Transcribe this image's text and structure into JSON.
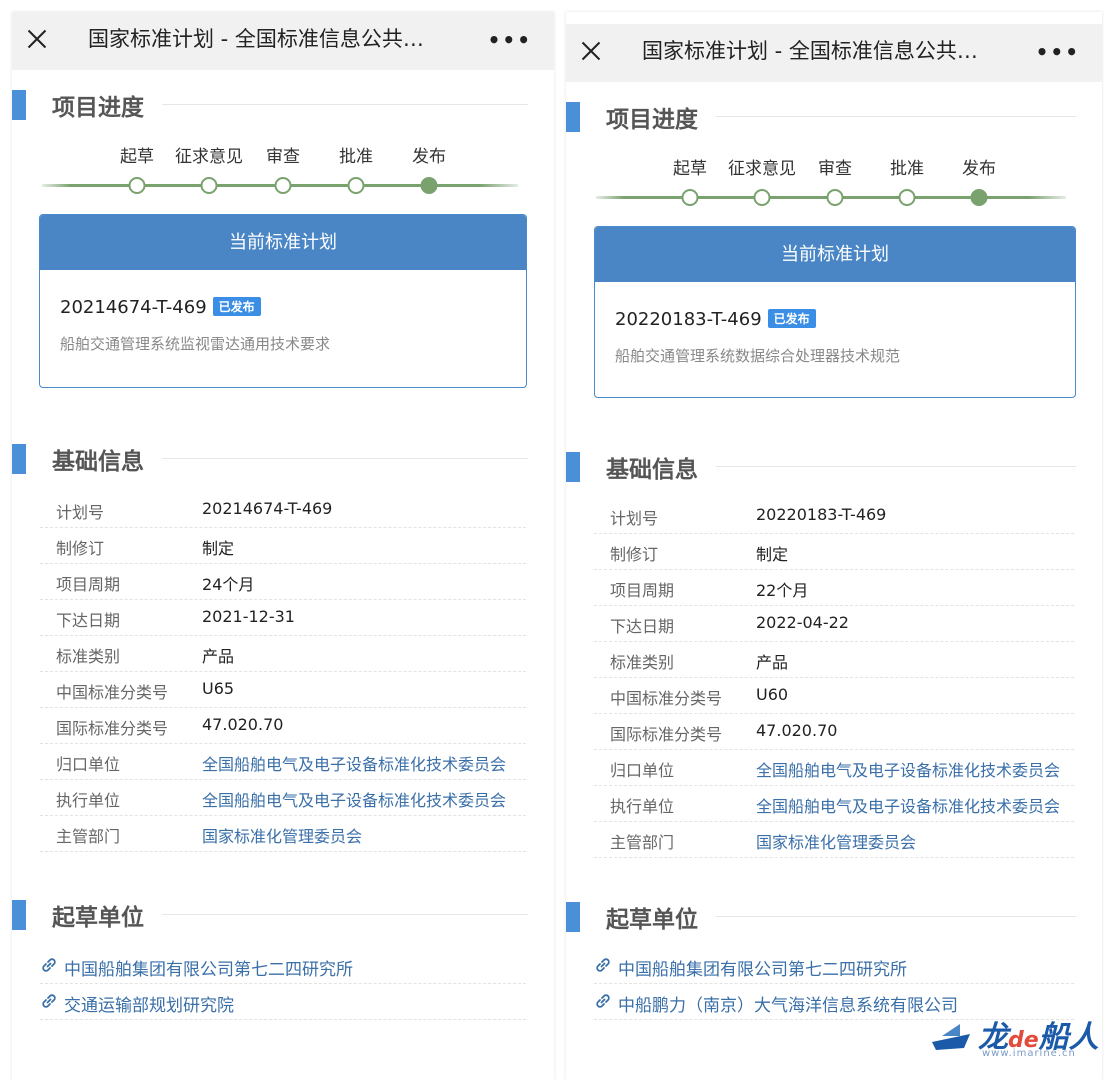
{
  "left": {
    "title": "国家标准计划 - 全国标准信息公共…",
    "progress_title": "项目进度",
    "steps": [
      "起草",
      "征求意见",
      "审查",
      "批准",
      "发布"
    ],
    "card": {
      "header": "当前标准计划",
      "plan_no": "20214674-T-469",
      "badge": "已发布",
      "name": "船舶交通管理系统监视雷达通用技术要求"
    },
    "basic_title": "基础信息",
    "info": [
      {
        "k": "计划号",
        "v": "20214674-T-469"
      },
      {
        "k": "制修订",
        "v": "制定"
      },
      {
        "k": "项目周期",
        "v": "24个月"
      },
      {
        "k": "下达日期",
        "v": "2021-12-31"
      },
      {
        "k": "标准类别",
        "v": "产品"
      },
      {
        "k": "中国标准分类号",
        "v": "U65"
      },
      {
        "k": "国际标准分类号",
        "v": "47.020.70"
      },
      {
        "k": "归口单位",
        "v": "全国船舶电气及电子设备标准化技术委员会"
      },
      {
        "k": "执行单位",
        "v": "全国船舶电气及电子设备标准化技术委员会"
      },
      {
        "k": "主管部门",
        "v": "国家标准化管理委员会"
      }
    ],
    "draft_title": "起草单位",
    "orgs": [
      "中国船舶集团有限公司第七二四研究所",
      "交通运输部规划研究院"
    ]
  },
  "right": {
    "title": "国家标准计划 - 全国标准信息公共…",
    "progress_title": "项目进度",
    "steps": [
      "起草",
      "征求意见",
      "审查",
      "批准",
      "发布"
    ],
    "card": {
      "header": "当前标准计划",
      "plan_no": "20220183-T-469",
      "badge": "已发布",
      "name": "船舶交通管理系统数据综合处理器技术规范"
    },
    "basic_title": "基础信息",
    "info": [
      {
        "k": "计划号",
        "v": "20220183-T-469"
      },
      {
        "k": "制修订",
        "v": "制定"
      },
      {
        "k": "项目周期",
        "v": "22个月"
      },
      {
        "k": "下达日期",
        "v": "2022-04-22"
      },
      {
        "k": "标准类别",
        "v": "产品"
      },
      {
        "k": "中国标准分类号",
        "v": "U60"
      },
      {
        "k": "国际标准分类号",
        "v": "47.020.70"
      },
      {
        "k": "归口单位",
        "v": "全国船舶电气及电子设备标准化技术委员会"
      },
      {
        "k": "执行单位",
        "v": "全国船舶电气及电子设备标准化技术委员会"
      },
      {
        "k": "主管部门",
        "v": "国家标准化管理委员会"
      }
    ],
    "draft_title": "起草单位",
    "orgs": [
      "中国船舶集团有限公司第七二四研究所",
      "中船鹏力（南京）大气海洋信息系统有限公司"
    ]
  },
  "watermark": {
    "brand_a": "龙",
    "brand_de": "de",
    "brand_b": "船人",
    "site": "www.imarine.cn"
  },
  "colors": {
    "accent": "#4a86c6",
    "progress": "#7aa26f",
    "link": "#3a6fa8"
  }
}
